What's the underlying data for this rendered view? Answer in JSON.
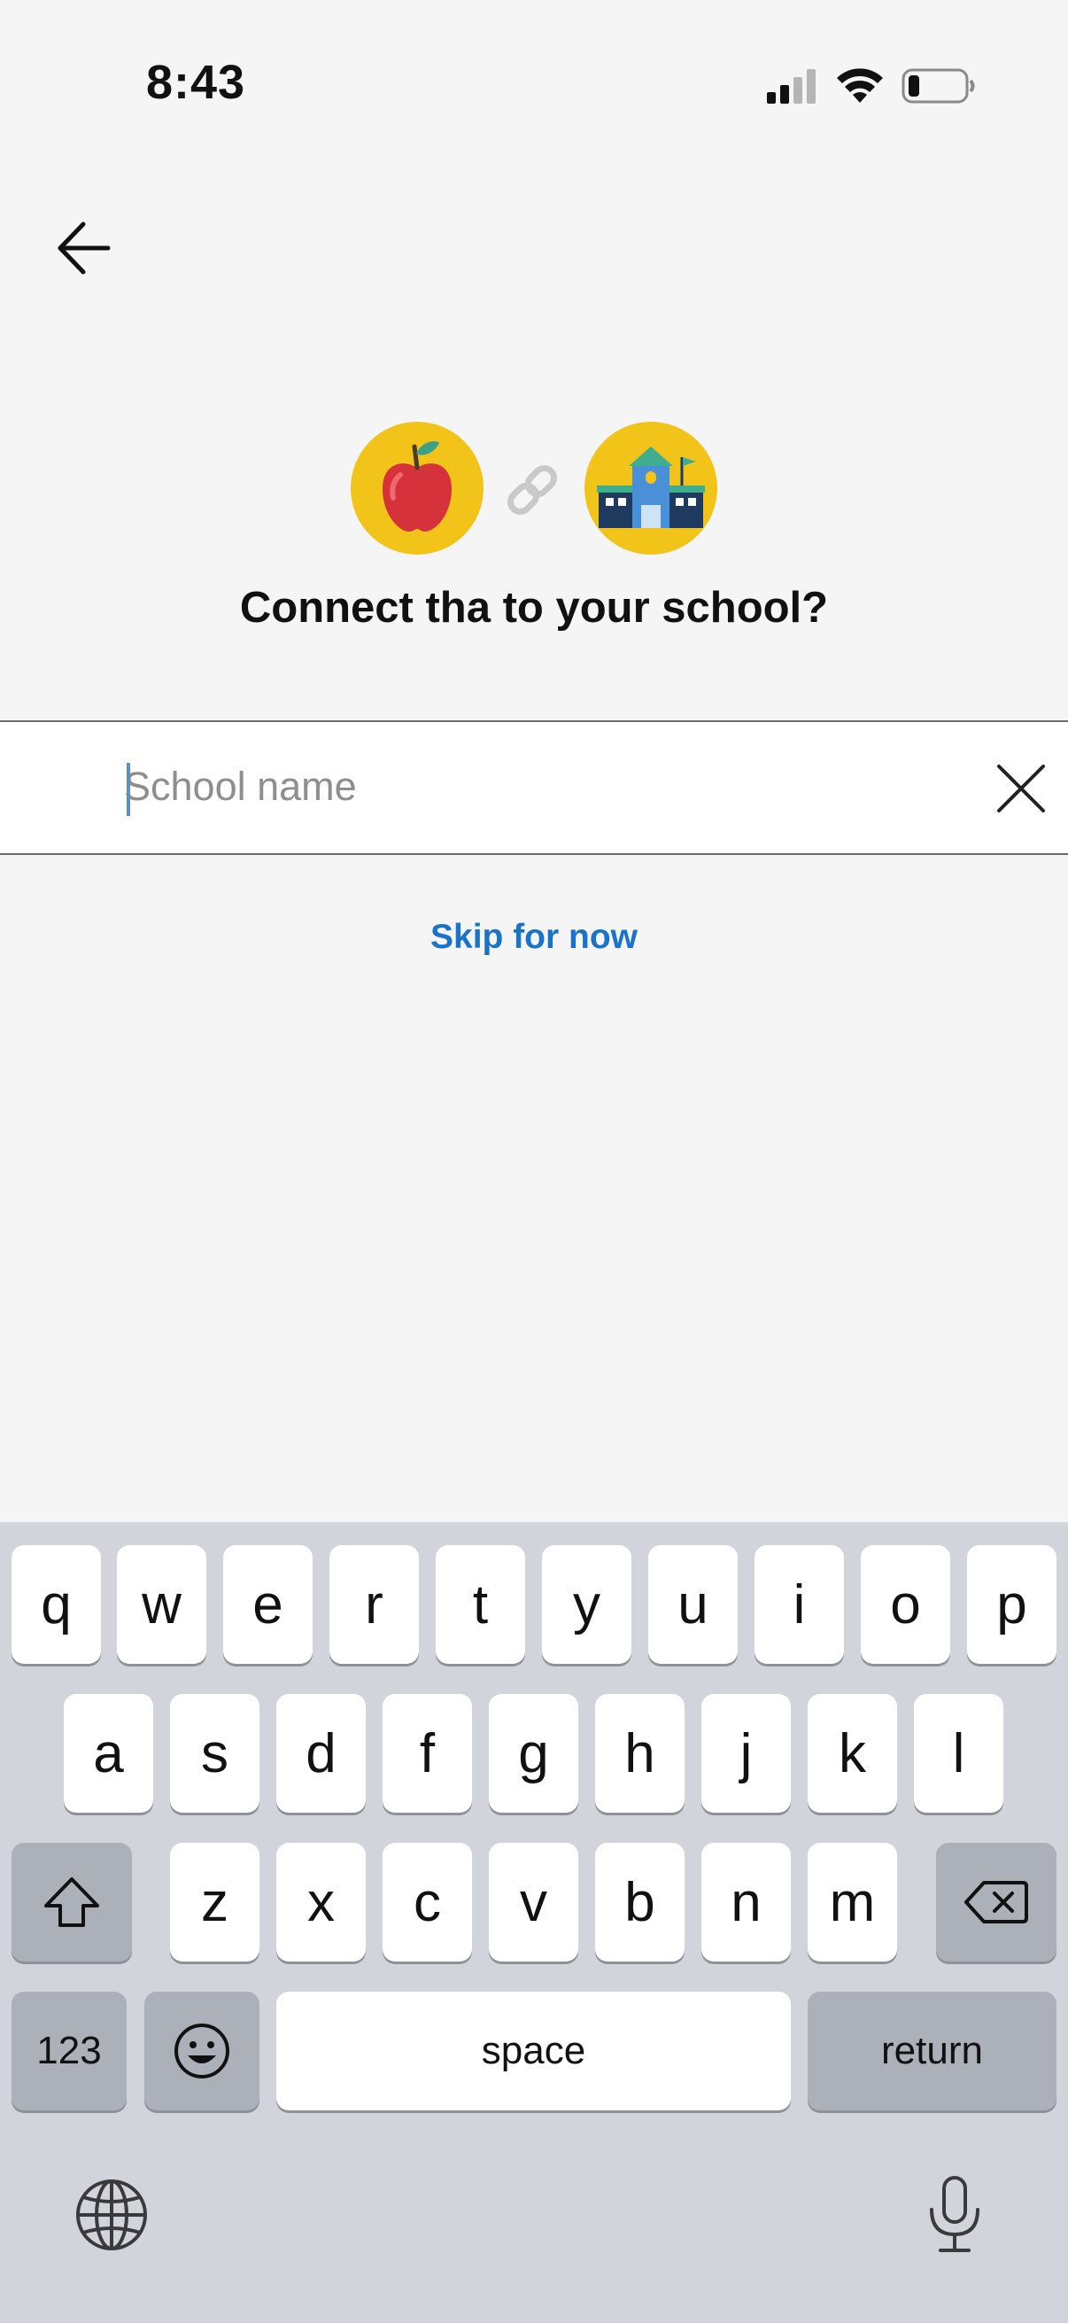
{
  "status_bar": {
    "time": "8:43"
  },
  "header": {
    "title": "Connect tha to your school?"
  },
  "search": {
    "placeholder": "School name",
    "value": ""
  },
  "skip_label": "Skip for now",
  "keyboard": {
    "row1": [
      "q",
      "w",
      "e",
      "r",
      "t",
      "y",
      "u",
      "i",
      "o",
      "p"
    ],
    "row2": [
      "a",
      "s",
      "d",
      "f",
      "g",
      "h",
      "j",
      "k",
      "l"
    ],
    "row3": [
      "z",
      "x",
      "c",
      "v",
      "b",
      "n",
      "m"
    ],
    "numbers_label": "123",
    "space_label": "space",
    "return_label": "return"
  },
  "colors": {
    "accent_yellow": "#f2c318",
    "link_blue": "#1a73c8"
  },
  "icons": [
    "signal-icon",
    "wifi-icon",
    "battery-icon",
    "back-arrow-icon",
    "apple-icon",
    "link-icon",
    "school-icon",
    "clear-icon",
    "shift-icon",
    "backspace-icon",
    "emoji-icon",
    "globe-icon",
    "microphone-icon"
  ]
}
